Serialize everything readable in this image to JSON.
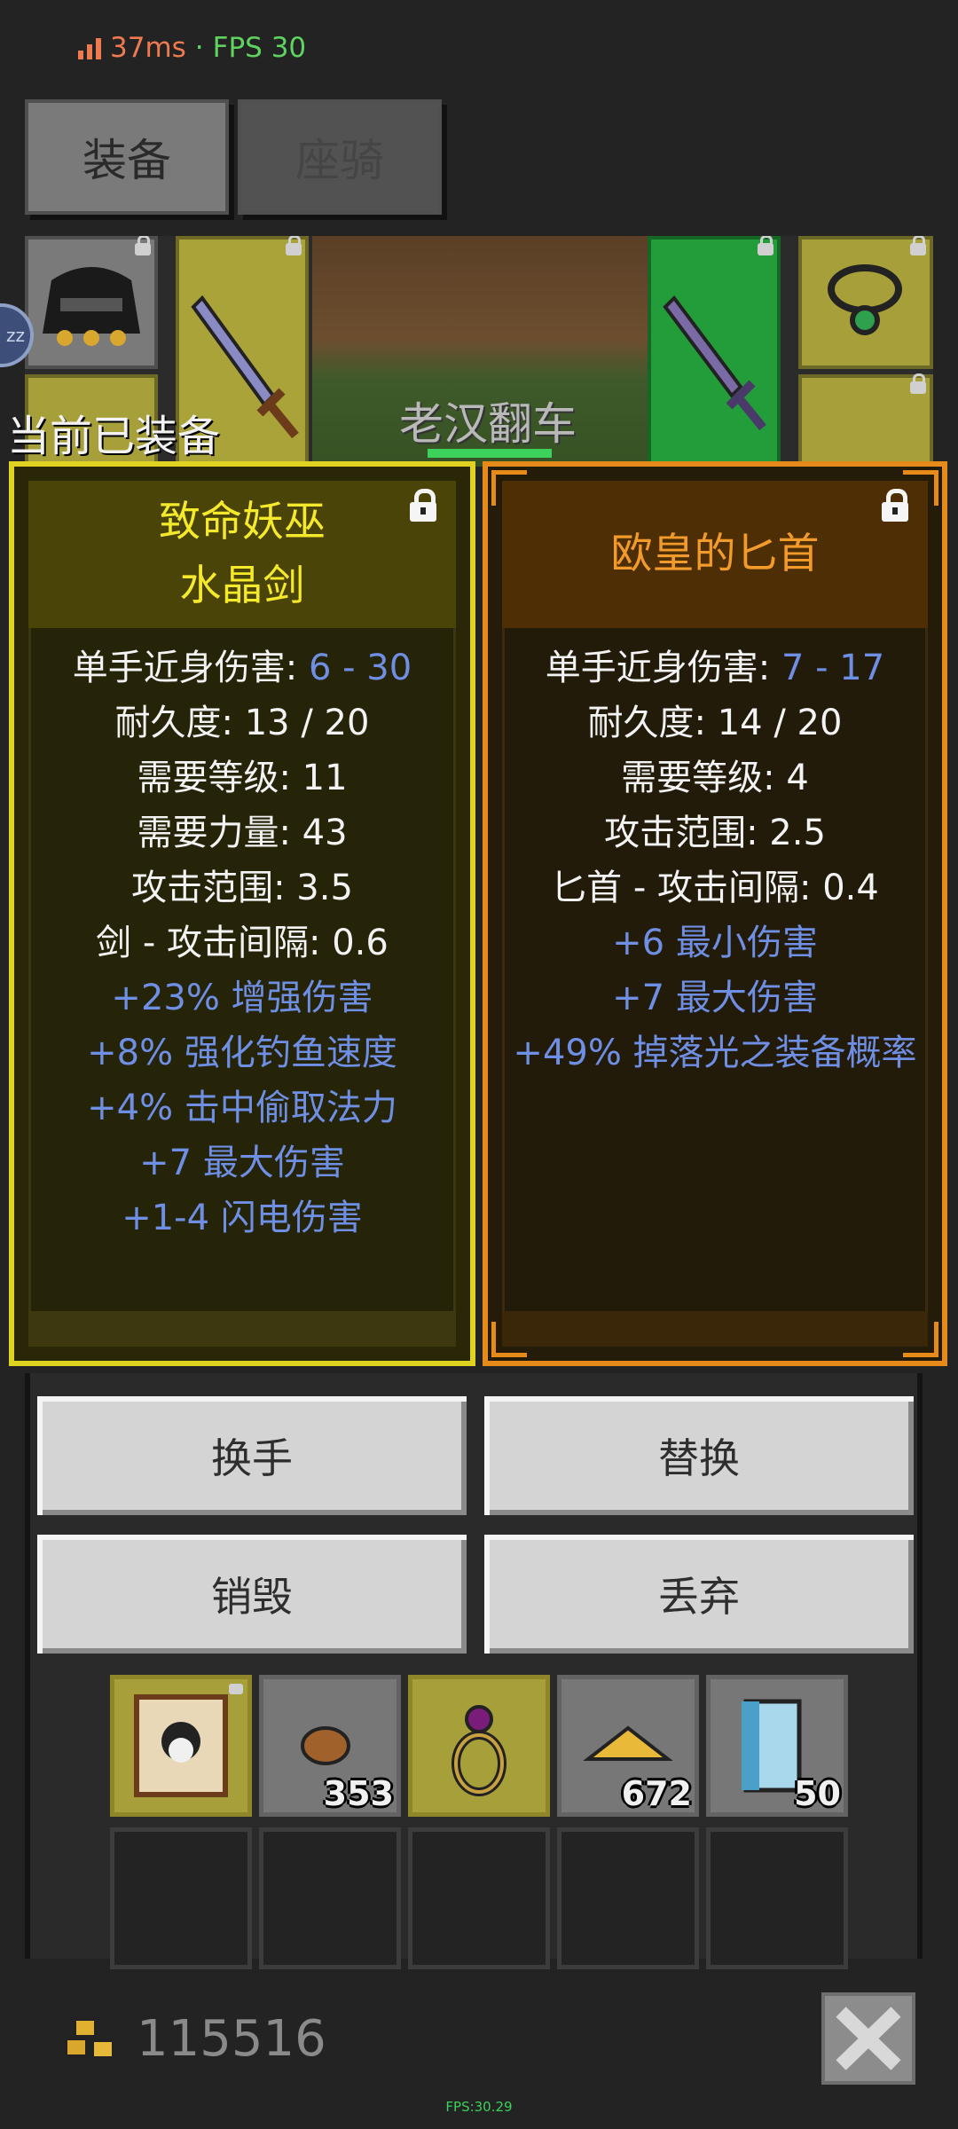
{
  "status": {
    "latency": "37ms",
    "separator": "·",
    "fps_label": "FPS 30"
  },
  "tabs": [
    {
      "label": "装备"
    },
    {
      "label": "座骑"
    }
  ],
  "character": {
    "name": "老汉翻车",
    "badge": "zz"
  },
  "equipped_label": "当前已装备",
  "left_item": {
    "title_line1": "致命妖巫",
    "title_line2": "水晶剑",
    "stats": [
      {
        "label": "单手近身伤害: ",
        "value": "6 - 30"
      },
      {
        "label": "耐久度: 13 / 20"
      },
      {
        "label": "需要等级: 11"
      },
      {
        "label": "需要力量: 43"
      },
      {
        "label": "攻击范围: 3.5"
      },
      {
        "label": "剑 - 攻击间隔: 0.6"
      }
    ],
    "bonuses": [
      "+23% 增强伤害",
      "+8% 强化钓鱼速度",
      "+4% 击中偷取法力",
      "+7 最大伤害",
      "+1-4 闪电伤害"
    ]
  },
  "right_item": {
    "title": "欧皇的匕首",
    "stats": [
      {
        "label": "单手近身伤害: ",
        "value": "7 - 17"
      },
      {
        "label": "耐久度: 14 / 20"
      },
      {
        "label": "需要等级: 4"
      },
      {
        "label": "攻击范围: 2.5"
      },
      {
        "label": "匕首 - 攻击间隔: 0.4"
      }
    ],
    "bonuses": [
      "+6 最小伤害",
      "+7 最大伤害",
      "+49% 掉落光之装备概率"
    ]
  },
  "actions": {
    "swap_hand": "换手",
    "replace": "替换",
    "destroy": "销毁",
    "drop": "丢弃"
  },
  "inventory_counts": [
    "353",
    "672",
    "50"
  ],
  "gold": "115516",
  "bottom_fps": "FPS:30.29",
  "colors": {
    "unique_yellow": "#f4e92a",
    "set_orange": "#f39b2a",
    "magic_blue": "#6f8fe5",
    "fps_green": "#3bd15a"
  }
}
